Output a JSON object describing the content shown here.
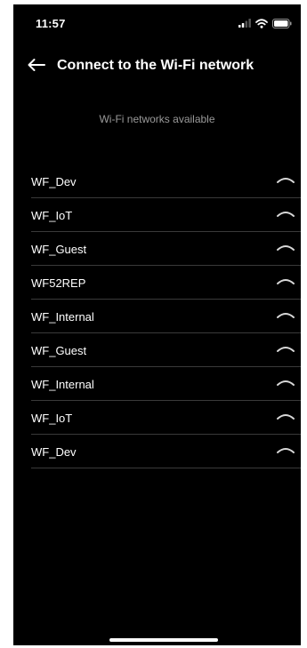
{
  "status_bar": {
    "time": "11:57",
    "signal_icon": "cellular-signal-icon",
    "wifi_icon": "wifi-status-icon",
    "battery_icon": "battery-icon"
  },
  "header": {
    "back_icon": "arrow-left-icon",
    "title": "Connect to the Wi-Fi network"
  },
  "section_label": "Wi-Fi networks available",
  "networks": [
    {
      "name": "WF_Dev",
      "icon": "wifi-signal-icon"
    },
    {
      "name": "WF_IoT",
      "icon": "wifi-signal-icon"
    },
    {
      "name": "WF_Guest",
      "icon": "wifi-signal-icon"
    },
    {
      "name": "WF52REP",
      "icon": "wifi-signal-icon"
    },
    {
      "name": "WF_Internal",
      "icon": "wifi-signal-icon"
    },
    {
      "name": "WF_Guest",
      "icon": "wifi-signal-icon"
    },
    {
      "name": "WF_Internal",
      "icon": "wifi-signal-icon"
    },
    {
      "name": "WF_IoT",
      "icon": "wifi-signal-icon"
    },
    {
      "name": "WF_Dev",
      "icon": "wifi-signal-icon"
    }
  ],
  "colors": {
    "background": "#000000",
    "text": "#ffffff",
    "muted_text": "#9a9a9a",
    "divider": "#3a3a3a"
  }
}
